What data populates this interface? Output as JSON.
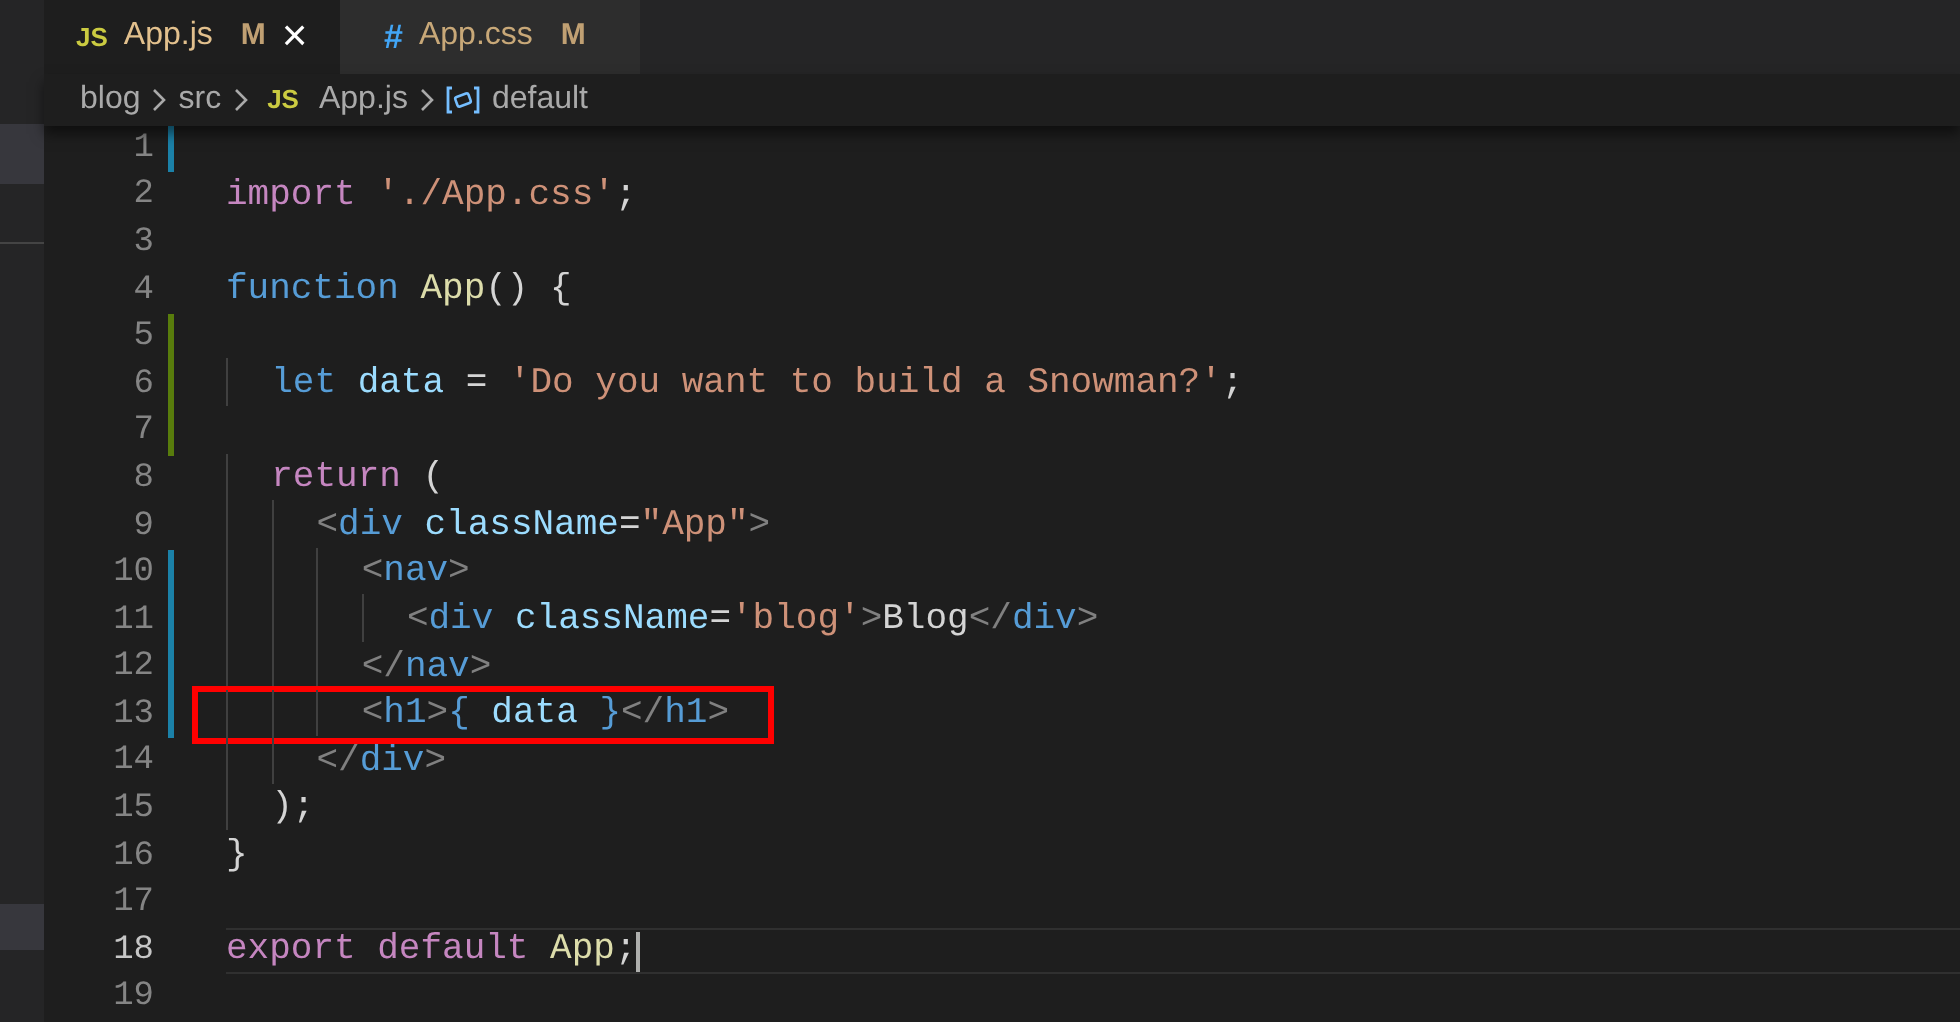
{
  "tabs": [
    {
      "label": "App.js",
      "badge": "JS",
      "status": "M",
      "selected": true,
      "close": "×"
    },
    {
      "label": "App.css",
      "badge": "#",
      "status": "M",
      "selected": false
    }
  ],
  "breadcrumb": [
    {
      "label": "blog",
      "kind": "folder"
    },
    {
      "label": "src",
      "kind": "folder"
    },
    {
      "label": "App.js",
      "kind": "file",
      "badge": "JS"
    },
    {
      "label": "default",
      "kind": "symbol"
    }
  ],
  "lines": [
    {
      "number": "1",
      "modified": true
    },
    {
      "number": "2",
      "tokens": [
        {
          "kind": "control",
          "text": "import "
        },
        {
          "kind": "string",
          "text": "'./App.css'"
        },
        {
          "kind": "plain",
          "text": ";"
        }
      ]
    },
    {
      "number": "3"
    },
    {
      "number": "4",
      "tokens": [
        {
          "kind": "keyword",
          "text": "function "
        },
        {
          "kind": "func",
          "text": "App"
        },
        {
          "kind": "plain",
          "text": "() {"
        }
      ]
    },
    {
      "number": "5",
      "added": true
    },
    {
      "number": "6",
      "added": true,
      "tokens": [
        {
          "kind": "keyword",
          "text": "  let "
        },
        {
          "kind": "var",
          "text": "data "
        },
        {
          "kind": "plain",
          "text": "= "
        },
        {
          "kind": "string",
          "text": "'Do you want to build a Snowman?'"
        },
        {
          "kind": "plain",
          "text": ";"
        }
      ]
    },
    {
      "number": "7",
      "added": true
    },
    {
      "number": "8",
      "tokens": [
        {
          "kind": "control",
          "text": "  return "
        },
        {
          "kind": "plain",
          "text": "("
        }
      ]
    },
    {
      "number": "9",
      "tokens": [
        {
          "kind": "bracket",
          "text": "    <"
        },
        {
          "kind": "tag",
          "text": "div "
        },
        {
          "kind": "attr",
          "text": "className"
        },
        {
          "kind": "plain",
          "text": "="
        },
        {
          "kind": "string",
          "text": "\"App\""
        },
        {
          "kind": "bracket",
          "text": ">"
        }
      ]
    },
    {
      "number": "10",
      "modified": true,
      "tokens": [
        {
          "kind": "bracket",
          "text": "      <"
        },
        {
          "kind": "tag",
          "text": "nav"
        },
        {
          "kind": "bracket",
          "text": ">"
        }
      ]
    },
    {
      "number": "11",
      "modified": true,
      "tokens": [
        {
          "kind": "bracket",
          "text": "        <"
        },
        {
          "kind": "tag",
          "text": "div "
        },
        {
          "kind": "attr",
          "text": "className"
        },
        {
          "kind": "plain",
          "text": "="
        },
        {
          "kind": "string",
          "text": "'blog'"
        },
        {
          "kind": "bracket",
          "text": ">"
        },
        {
          "kind": "plain",
          "text": "Blog"
        },
        {
          "kind": "bracket",
          "text": "</"
        },
        {
          "kind": "tag",
          "text": "div"
        },
        {
          "kind": "bracket",
          "text": ">"
        }
      ]
    },
    {
      "number": "12",
      "modified": true,
      "tokens": [
        {
          "kind": "bracket",
          "text": "      </"
        },
        {
          "kind": "tag",
          "text": "nav"
        },
        {
          "kind": "bracket",
          "text": ">"
        }
      ]
    },
    {
      "number": "13",
      "modified": true,
      "highlighted": true,
      "tokens": [
        {
          "kind": "bracket",
          "text": "      <"
        },
        {
          "kind": "tag",
          "text": "h1"
        },
        {
          "kind": "bracket",
          "text": ">"
        },
        {
          "kind": "keyword",
          "text": "{ "
        },
        {
          "kind": "var",
          "text": "data "
        },
        {
          "kind": "keyword",
          "text": "}"
        },
        {
          "kind": "bracket",
          "text": "</"
        },
        {
          "kind": "tag",
          "text": "h1"
        },
        {
          "kind": "bracket",
          "text": ">"
        }
      ]
    },
    {
      "number": "14",
      "tokens": [
        {
          "kind": "bracket",
          "text": "    </"
        },
        {
          "kind": "tag",
          "text": "div"
        },
        {
          "kind": "bracket",
          "text": ">"
        }
      ]
    },
    {
      "number": "15",
      "tokens": [
        {
          "kind": "plain",
          "text": "  );"
        }
      ]
    },
    {
      "number": "16",
      "tokens": [
        {
          "kind": "plain",
          "text": "}"
        }
      ]
    },
    {
      "number": "17"
    },
    {
      "number": "18",
      "current": true,
      "tokens": [
        {
          "kind": "control",
          "text": "export default "
        },
        {
          "kind": "func",
          "text": "App"
        },
        {
          "kind": "plain",
          "text": ";"
        }
      ]
    },
    {
      "number": "19"
    }
  ]
}
